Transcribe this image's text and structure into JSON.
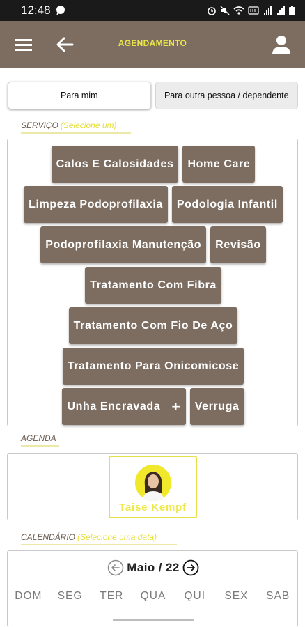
{
  "status_bar": {
    "time": "12:48"
  },
  "app_bar": {
    "title": "AGENDAMENTO"
  },
  "recipient_tabs": [
    {
      "label": "Para mim"
    },
    {
      "label": "Para outra pessoa / dependente"
    }
  ],
  "service_section": {
    "label": "SERVIÇO",
    "hint": "(Selecione um)"
  },
  "services": [
    "Calos E Calosidades",
    "Home Care",
    "Limpeza Podoprofilaxia",
    "Podologia Infantil",
    "Podoprofilaxia Manutenção",
    "Revisão",
    "Tratamento Com Fibra",
    "Tratamento Com Fio De Aço",
    "Tratamento Para Onicomicose",
    "Unha Encravada",
    "Verruga"
  ],
  "more_symbol": "+",
  "agenda_section": {
    "label": "AGENDA"
  },
  "professional": {
    "name": "Taise Kempf"
  },
  "calendar_section": {
    "label": "CALENDÁRIO",
    "hint": "(Selecione uma data)"
  },
  "calendar": {
    "month_label": "Maio / 22",
    "weekdays": [
      "DOM",
      "SEG",
      "TER",
      "QUA",
      "QUI",
      "SEX",
      "SAB"
    ]
  },
  "colors": {
    "primary": "#7d6d61",
    "accent": "#e6df3a"
  },
  "icons": [
    "menu-icon",
    "back-arrow-icon",
    "user-icon",
    "prev-month-icon",
    "next-month-icon"
  ]
}
